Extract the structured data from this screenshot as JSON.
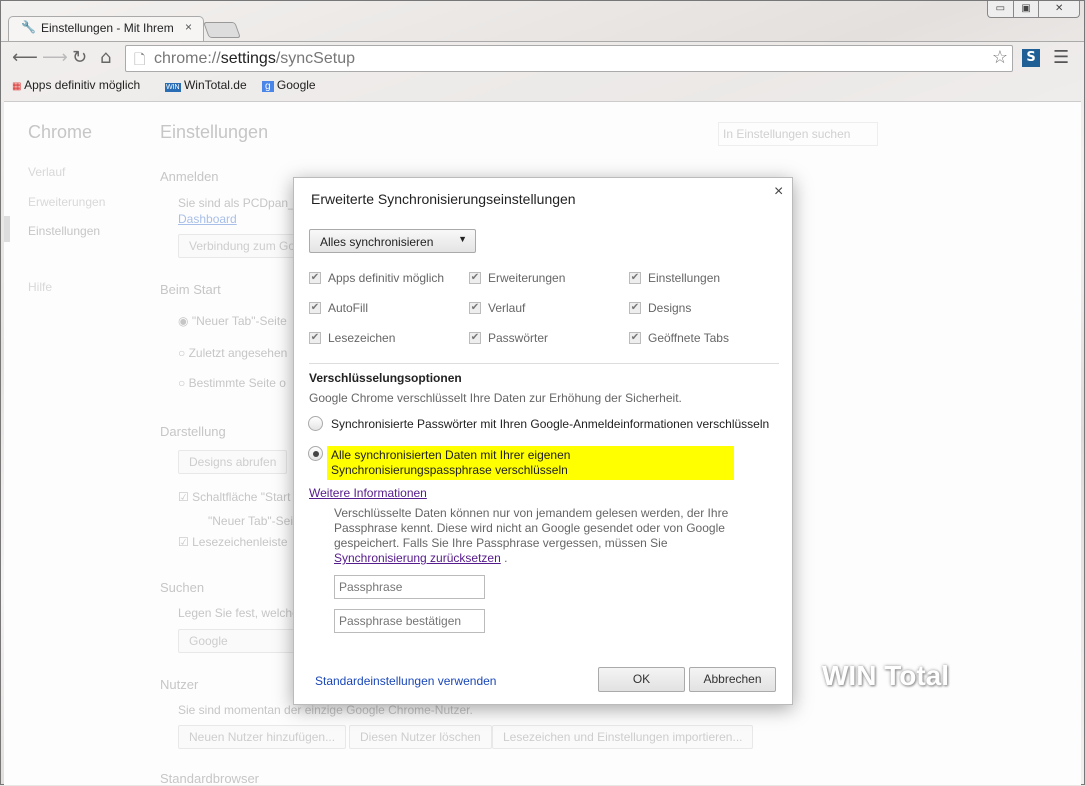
{
  "window": {
    "minimize": "▭",
    "maximize": "▣",
    "close": "✕"
  },
  "tab": {
    "title": "Einstellungen - Mit Ihrem",
    "close": "×"
  },
  "toolbar": {
    "url_scheme": "chrome://",
    "url_host": "settings",
    "url_path": "/syncSetup"
  },
  "bookmarks": [
    {
      "label": "Apps definitiv möglich"
    },
    {
      "label": "WinTotal.de"
    },
    {
      "label": "Google"
    }
  ],
  "extension": {
    "label": "S"
  },
  "settings": {
    "brand": "Chrome",
    "title": "Einstellungen",
    "search_placeholder": "In Einstellungen suchen",
    "nav": [
      "Verlauf",
      "Erweiterungen",
      "Einstellungen",
      "Hilfe"
    ],
    "anmelden": {
      "heading": "Anmelden",
      "text": "Sie sind als PCDpan_fe",
      "link": "Dashboard",
      "button": "Verbindung zum Go"
    },
    "start": {
      "heading": "Beim Start",
      "options": [
        "\"Neuer Tab\"-Seite",
        "Zuletzt angesehen",
        "Bestimmte Seite o"
      ]
    },
    "darstellung": {
      "heading": "Darstellung",
      "button": "Designs abrufen",
      "check1": "Schaltfläche \"Start",
      "sub1": "\"Neuer Tab\"-Sei",
      "check2": "Lesezeichenleiste"
    },
    "suchen": {
      "heading": "Suchen",
      "text": "Legen Sie fest, welche",
      "select": "Google"
    },
    "nutzer": {
      "heading": "Nutzer",
      "text": "Sie sind momentan der einzige Google Chrome-Nutzer.",
      "buttons": [
        "Neuen Nutzer hinzufügen...",
        "Diesen Nutzer löschen",
        "Lesezeichen und Einstellungen importieren..."
      ]
    },
    "standard": {
      "heading": "Standardbrowser"
    }
  },
  "dialog": {
    "title": "Erweiterte Synchronisierungseinstellungen",
    "close": "×",
    "sync_select": "Alles synchronisieren",
    "checkboxes": [
      "Apps definitiv möglich",
      "Erweiterungen",
      "Einstellungen",
      "AutoFill",
      "Verlauf",
      "Designs",
      "Lesezeichen",
      "Passwörter",
      "Geöffnete Tabs"
    ],
    "enc_heading": "Verschlüsselungsoptionen",
    "enc_desc": "Google Chrome verschlüsselt Ihre Daten zur Erhöhung der Sicherheit.",
    "radio1": "Synchronisierte Passwörter mit Ihren Google-Anmeldeinformationen verschlüsseln",
    "radio2": "Alle synchronisierten Daten mit Ihrer eigenen Synchronisierungspassphrase verschlüsseln",
    "more_info": "Weitere Informationen",
    "info_text": "Verschlüsselte Daten können nur von jemandem gelesen werden, der Ihre Passphrase kennt. Diese wird nicht an Google gesendet oder von Google gespeichert. Falls Sie Ihre Passphrase vergessen, müssen Sie",
    "reset_link": "Synchronisierung zurücksetzen",
    "info_end": " .",
    "passphrase_placeholder": "Passphrase",
    "confirm_placeholder": "Passphrase bestätigen",
    "defaults_link": "Standardeinstellungen verwenden",
    "ok": "OK",
    "cancel": "Abbrechen"
  },
  "watermark": "WIN Total",
  "colors": {
    "highlight": "#ffff00",
    "link": "#551a8b",
    "defaults_link": "#1a47b8"
  }
}
